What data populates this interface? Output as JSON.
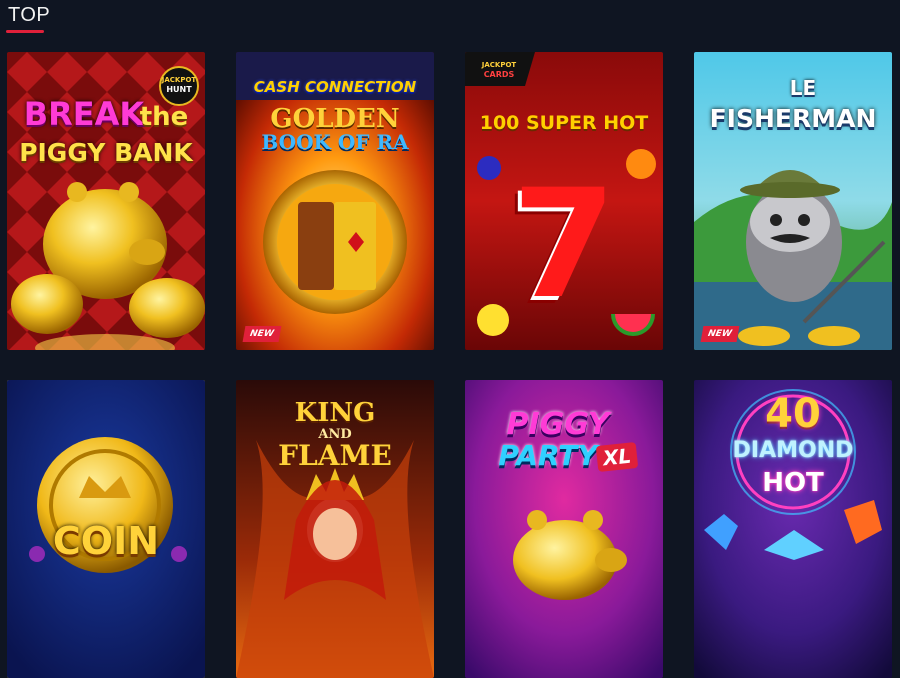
{
  "section": {
    "title": "TOP"
  },
  "games": [
    {
      "title_line1": "BREAK",
      "title_word2": "the",
      "title_line2": "PIGGY BANK",
      "badge_line1": "JACKPOT",
      "badge_line2": "HUNT",
      "new": false
    },
    {
      "banner": "CASH CONNECTION",
      "title_line1": "GOLDEN",
      "title_line2": "BOOK OF RA",
      "new": true,
      "new_label": "NEW"
    },
    {
      "banner_line1": "JACKPOT",
      "banner_line2": "CARDS",
      "title": "100 SUPER HOT",
      "symbol": "7",
      "new": false
    },
    {
      "title_line1": "LE",
      "title_line2": "FISHERMAN",
      "new": true,
      "new_label": "NEW"
    },
    {
      "title": "COIN",
      "new": false
    },
    {
      "title_line1": "KING",
      "title_word2": "AND",
      "title_line2": "FLAME",
      "new": false
    },
    {
      "title_line1": "PIGGY",
      "title_line2": "PARTY",
      "title_suffix": "XL",
      "new": false
    },
    {
      "title_line1": "40",
      "title_line2": "DIAMOND",
      "title_line3": "HOT",
      "new": false
    }
  ],
  "colors": {
    "accent": "#e0203a",
    "selected": "#f5d000",
    "background": "#0f1522"
  }
}
